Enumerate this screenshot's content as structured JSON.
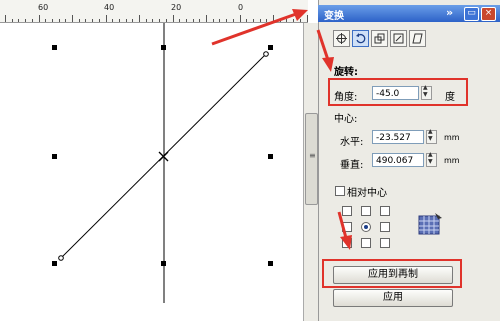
{
  "ruler": {
    "labels": [
      "60",
      "40",
      "20",
      "0"
    ]
  },
  "docker": {
    "title": "变换",
    "collapse_icon": "double-chevron-icon",
    "pin_icon": "pin-icon",
    "close_icon": "close-icon"
  },
  "toolbar": {
    "buttons": [
      "position-icon",
      "rotate-icon",
      "scale-icon",
      "size-icon",
      "skew-icon"
    ],
    "active": "rotate-icon"
  },
  "rotation": {
    "section_label": "旋转:",
    "angle_label": "角度:",
    "angle_value": "-45.0",
    "angle_unit": "度"
  },
  "center": {
    "section_label": "中心:",
    "h_label": "水平:",
    "h_value": "-23.527",
    "v_label": "垂直:",
    "v_value": "490.067",
    "unit": "mm"
  },
  "relative_center": {
    "label": "相对中心",
    "checked": false
  },
  "actions": {
    "apply_duplicate": "应用到再制",
    "apply": "应用"
  },
  "colors": {
    "annotation": "#e0332b",
    "title_bar": "#2d62c8",
    "panel_bg": "#ecebe5"
  }
}
